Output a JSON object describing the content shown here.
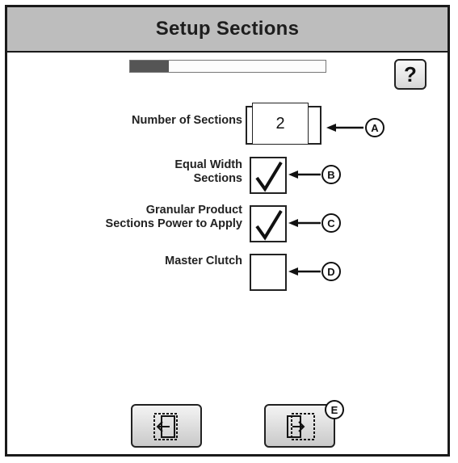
{
  "screen": {
    "title": "Setup Sections",
    "progress": 0.2,
    "help_label": "?"
  },
  "fields": {
    "number_of_sections": {
      "label": "Number of Sections",
      "value": "2"
    },
    "equal_width": {
      "label_line1": "Equal Width",
      "label_line2": "Sections",
      "checked": true
    },
    "granular_product": {
      "label_line1": "Granular Product",
      "label_line2": "Sections Power to Apply",
      "checked": true
    },
    "master_clutch": {
      "label": "Master Clutch",
      "checked": false
    }
  },
  "callouts": {
    "a": "A",
    "b": "B",
    "c": "C",
    "d": "D",
    "e": "E"
  },
  "nav": {
    "back_icon": "exit-back-icon",
    "next_icon": "exit-next-icon"
  },
  "colors": {
    "titlebar": "#bdbdbd",
    "progress_fill": "#555555"
  }
}
